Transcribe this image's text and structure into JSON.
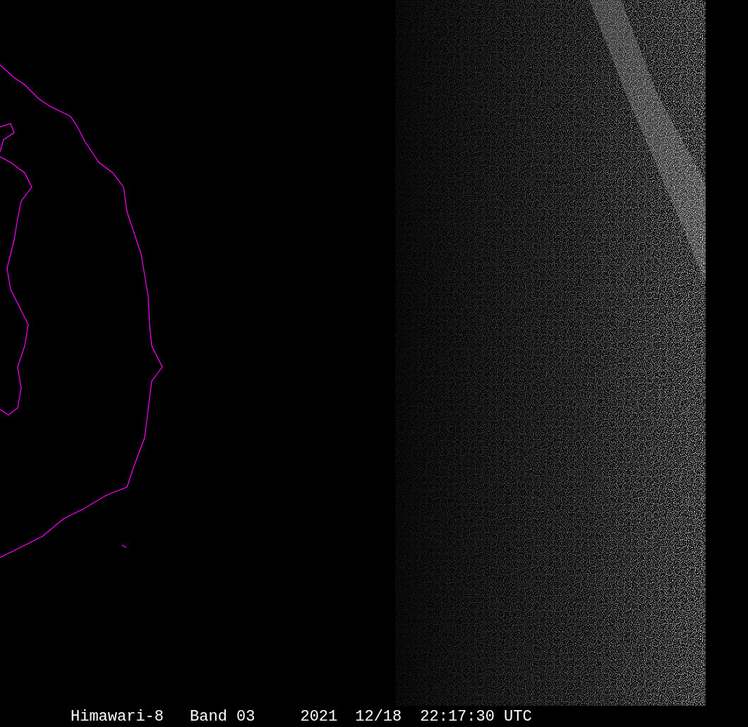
{
  "caption": [
    "Himawari-8",
    "Band 03",
    "2021",
    "12/18",
    "22:17:30 UTC"
  ]
}
